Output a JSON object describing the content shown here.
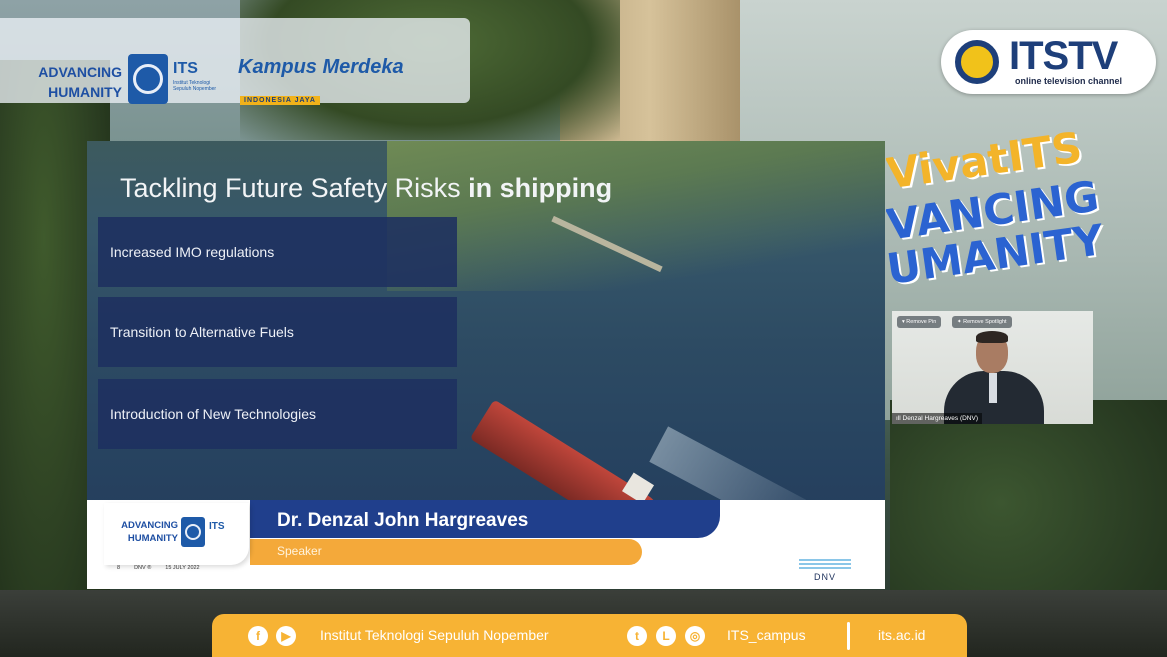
{
  "top_banner": {
    "advancing_line1": "ADVANCING",
    "advancing_line2": "HUMANITY",
    "its_label": "ITS",
    "its_subtitle": "Institut Teknologi Sepuluh Nopember",
    "kampus_merdeka": "Kampus Merdeka",
    "kampus_sub": "INDONESIA JAYA"
  },
  "tv_logo": {
    "name": "ITSTV",
    "tagline": "online television channel"
  },
  "slogan": {
    "line1": "VivatITS",
    "line2": "VANCING",
    "line3": "UMANITY"
  },
  "slide": {
    "title_regular": "Tackling Future Safety Risks ",
    "title_bold": "in shipping",
    "points": [
      "Increased IMO regulations",
      "Transition to Alternative Fuels",
      "Introduction of New Technologies"
    ]
  },
  "lower_third": {
    "advancing_line1": "ADVANCING",
    "advancing_line2": "HUMANITY",
    "its_label": "ITS",
    "speaker_name": "Dr. Denzal John Hargreaves",
    "speaker_role": "Speaker",
    "footer_num": "8",
    "footer_brand": "DNV ®",
    "footer_date": "15 JULY 2022",
    "dnv_logo": "DNV"
  },
  "video_tile": {
    "remove_pin": "Remove Pin",
    "remove_spotlight": "Remove Spotlight",
    "participant_name": "Denzal Hargreaves (DNV)"
  },
  "bottom_bar": {
    "institute": "Institut Teknologi Sepuluh Nopember",
    "handle": "ITS_campus",
    "website": "its.ac.id",
    "icons": [
      "facebook-icon",
      "youtube-icon",
      "twitter-icon",
      "line-icon",
      "instagram-icon"
    ]
  },
  "colors": {
    "its_blue": "#1e5aa8",
    "accent_orange": "#f7b334",
    "name_bar_blue": "#203f8c"
  }
}
